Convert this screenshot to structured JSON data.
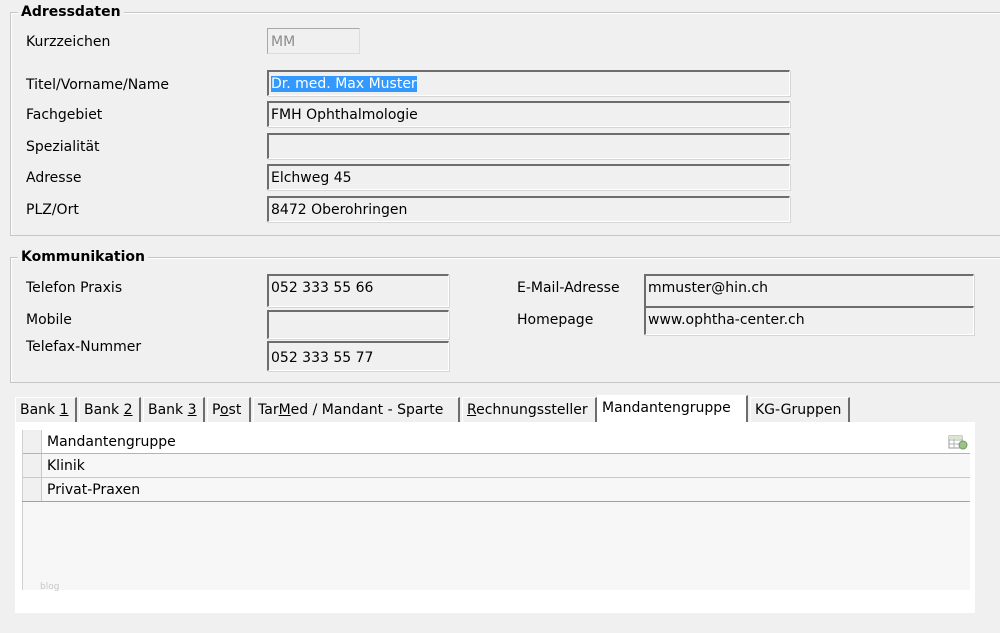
{
  "adressdaten": {
    "legend": "Adressdaten",
    "kurzzeichen_label": "Kurzzeichen",
    "kurzzeichen_value": "MM",
    "name_label": "Titel/Vorname/Name",
    "name_value": "Dr. med. Max Muster",
    "fachgebiet_label": "Fachgebiet",
    "fachgebiet_value": "FMH Ophthalmologie",
    "spezialitaet_label": "Spezialität",
    "spezialitaet_value": "",
    "adresse_label": "Adresse",
    "adresse_value": "Elchweg 45",
    "plzort_label": "PLZ/Ort",
    "plzort_value": "8472 Oberohringen"
  },
  "kommunikation": {
    "legend": "Kommunikation",
    "telefon_label": "Telefon Praxis",
    "telefon_value": "052 333 55 66",
    "mobile_label": "Mobile",
    "mobile_value": "",
    "telefax_label": "Telefax-Nummer",
    "telefax_value": "052 333 55 77",
    "email_label": "E-Mail-Adresse",
    "email_value": "mmuster@hin.ch",
    "homepage_label": "Homepage",
    "homepage_value": "www.ophtha-center.ch"
  },
  "tabs": [
    {
      "pre": "Bank ",
      "u": "1",
      "post": ""
    },
    {
      "pre": "Bank ",
      "u": "2",
      "post": ""
    },
    {
      "pre": "Bank ",
      "u": "3",
      "post": ""
    },
    {
      "pre": "P",
      "u": "o",
      "post": "st"
    },
    {
      "pre": "Tar",
      "u": "M",
      "post": "ed / Mandant - Sparte"
    },
    {
      "pre": "",
      "u": "R",
      "post": "echnungssteller"
    },
    {
      "pre": "Mandantengruppe",
      "u": "",
      "post": ""
    },
    {
      "pre": "KG-Gruppen",
      "u": "",
      "post": ""
    }
  ],
  "active_tab_index": 6,
  "grid": {
    "column_header": "Mandantengruppe",
    "rows": [
      "Klinik",
      "Privat-Praxen"
    ],
    "icon": "grid-settings-icon"
  },
  "watermark": "blog"
}
